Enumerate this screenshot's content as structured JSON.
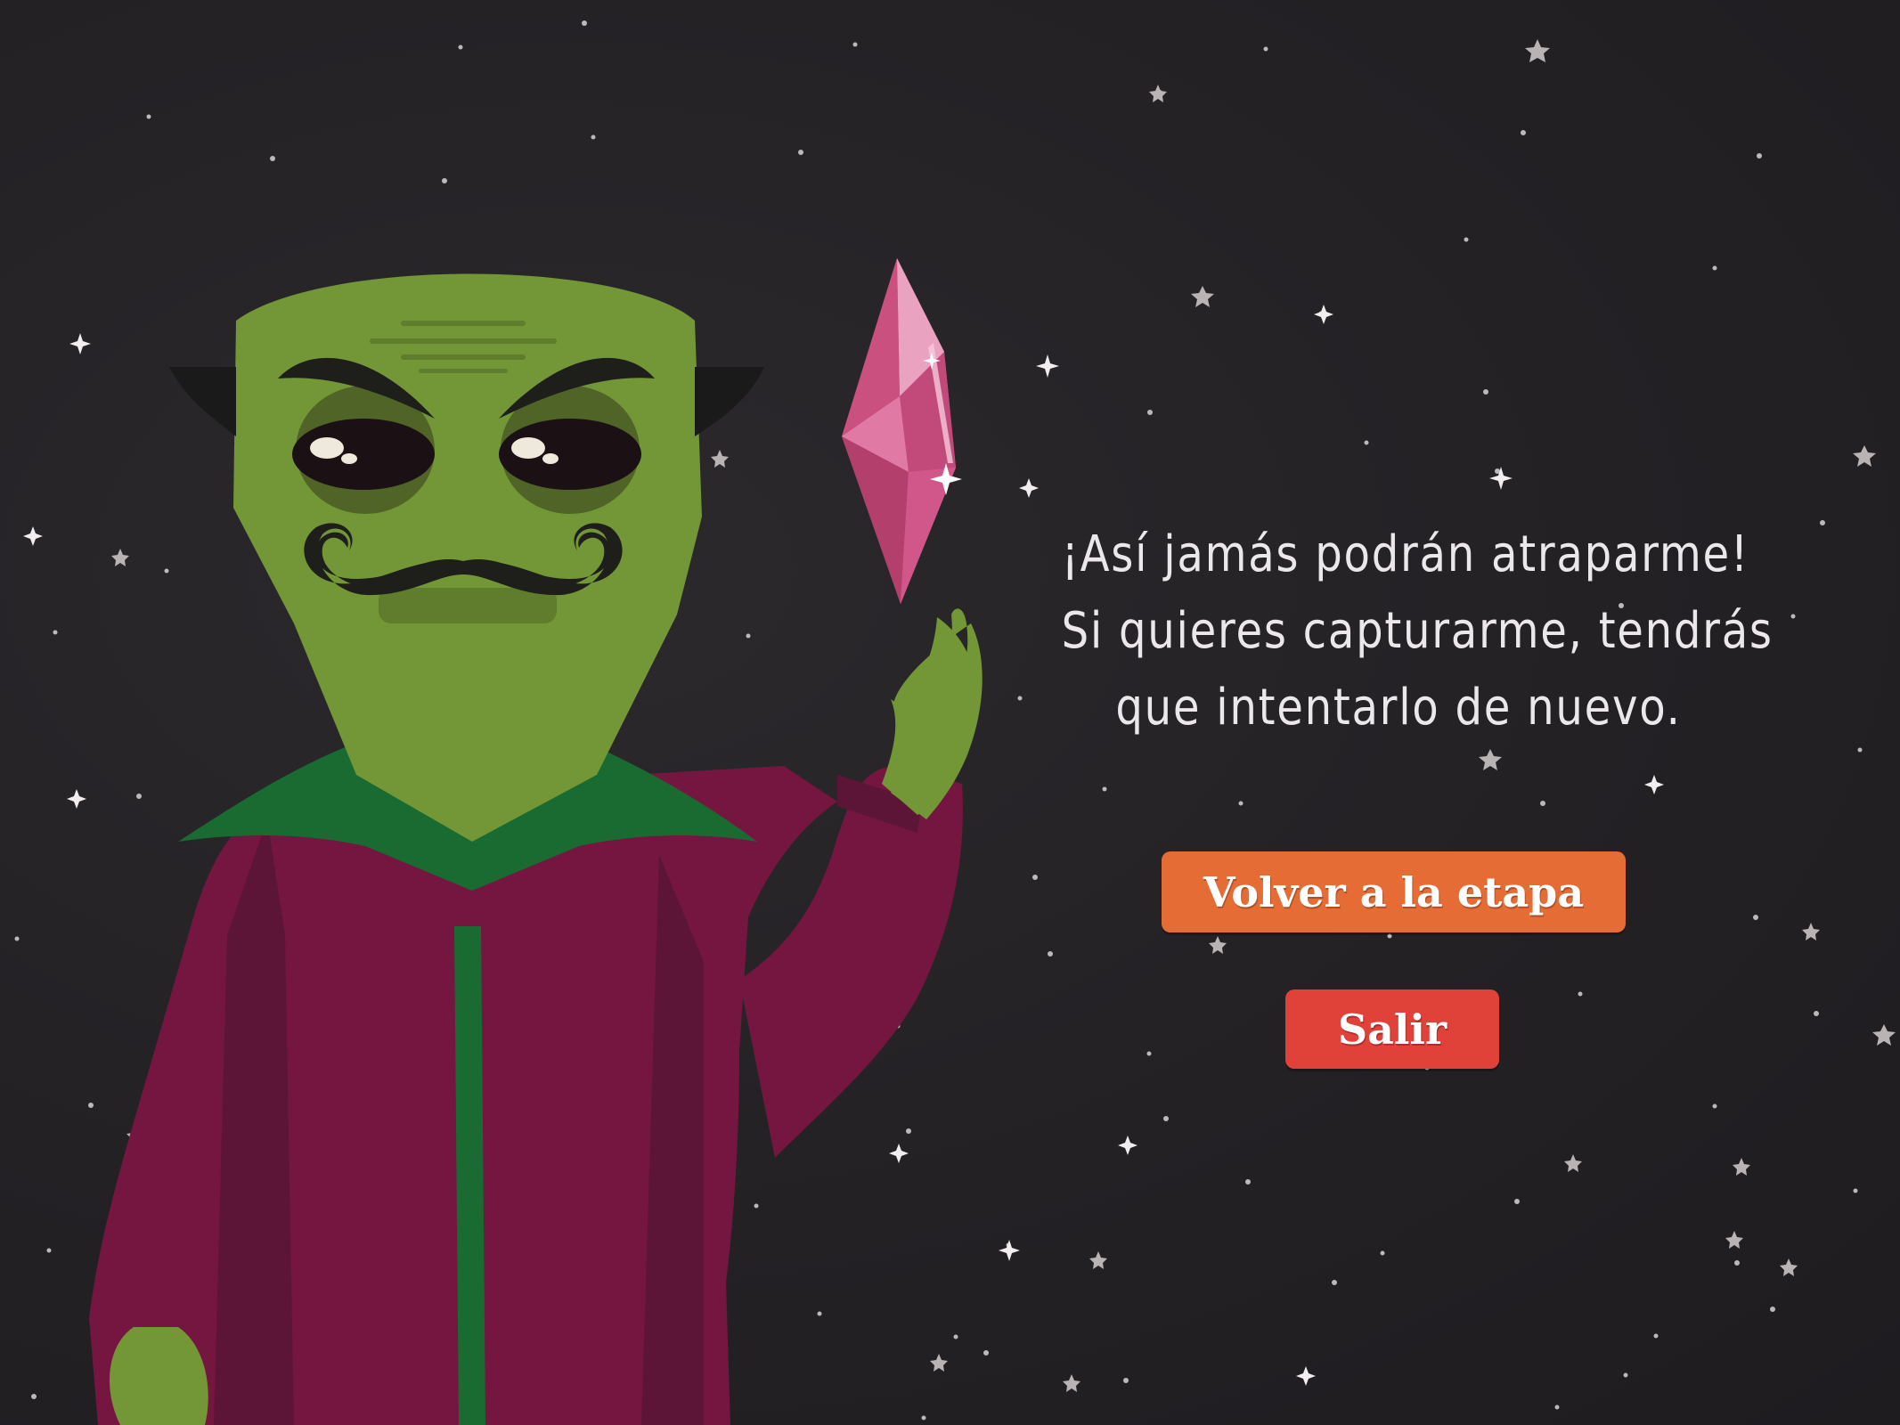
{
  "message": {
    "lines": [
      "¡Así jamás podrán atraparme!",
      "Si quieres capturarme, tendrás",
      "que intentarlo de nuevo."
    ]
  },
  "buttons": {
    "retry_label": "Volver a la etapa",
    "exit_label": "Salir"
  },
  "colors": {
    "background": "#232124",
    "retry_button": "#e56d35",
    "exit_button": "#e0423a",
    "text": "#ebe7ea",
    "alien_skin": "#739637",
    "robe": "#741640",
    "gem": "#d4608f"
  },
  "icons": {
    "character": "mustached-alien-icon",
    "gem": "pink-crystal-icon",
    "background": "starfield-icon"
  }
}
